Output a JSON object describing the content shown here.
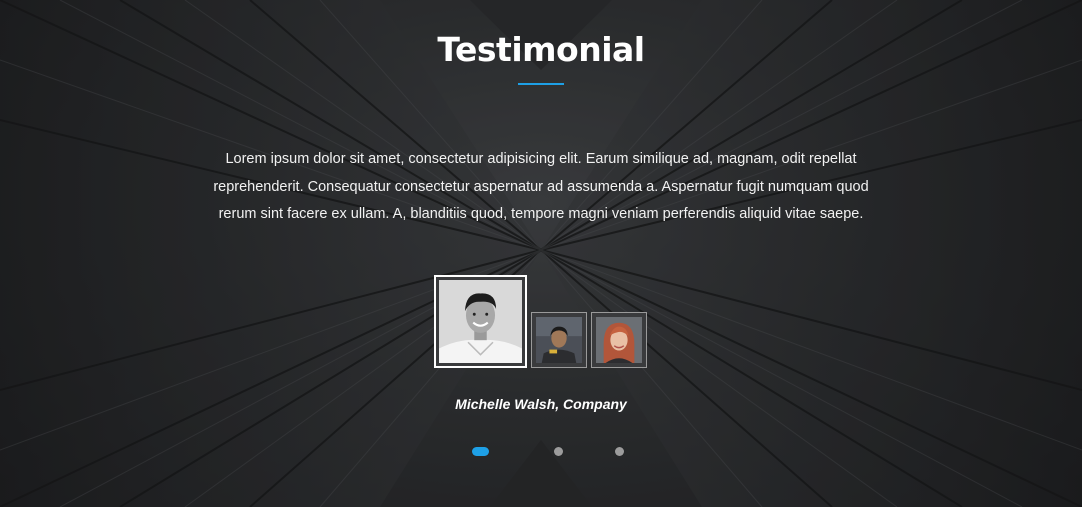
{
  "section": {
    "title": "Testimonial",
    "accent_color": "#1ea0e6"
  },
  "testimonial": {
    "quote": "Lorem ipsum dolor sit amet, consectetur adipisicing elit. Earum similique ad, magnam, odit repellat reprehenderit. Consequatur consectetur aspernatur ad assumenda a. Aspernatur fugit numquam quod rerum sint facere ex ullam. A, blanditiis quod, tempore magni veniam perferendis aliquid vitae saepe.",
    "author": "Michelle Walsh, Company"
  },
  "thumbnails": [
    {
      "icon": "avatar-man-smiling",
      "active": true
    },
    {
      "icon": "avatar-man-dark",
      "active": false
    },
    {
      "icon": "avatar-woman-redhead",
      "active": false
    }
  ],
  "pagination": {
    "count": 3,
    "active_index": 0
  }
}
